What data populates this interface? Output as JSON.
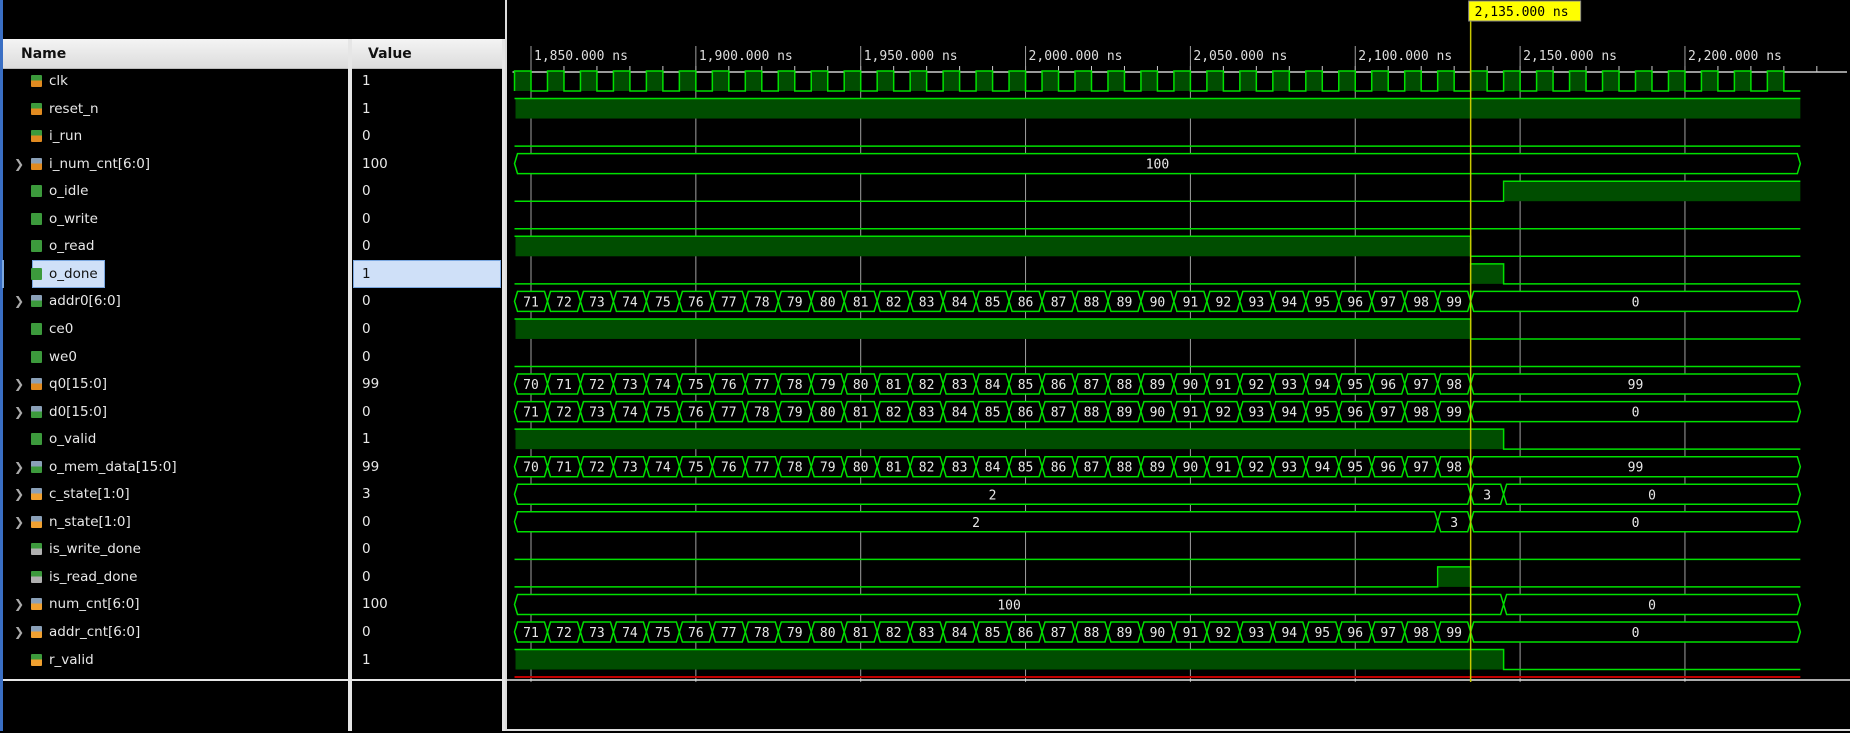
{
  "header": {
    "name_label": "Name",
    "value_label": "Value"
  },
  "colors": {
    "wave": "#00e000",
    "wave_fill": "#004d00",
    "cursor": "#c8c800",
    "cursor_label_bg": "#ffff00",
    "grid": "#a0a0a0",
    "selection": "#cfe0f8"
  },
  "timeline": {
    "unit": "ns",
    "range_ns": [
      1845,
      2235
    ],
    "major_ticks": [
      {
        "t": 1850,
        "label": "1,850.000 ns"
      },
      {
        "t": 1900,
        "label": "1,900.000 ns"
      },
      {
        "t": 1950,
        "label": "1,950.000 ns"
      },
      {
        "t": 2000,
        "label": "2,000.000 ns"
      },
      {
        "t": 2050,
        "label": "2,050.000 ns"
      },
      {
        "t": 2100,
        "label": "2,100.000 ns"
      },
      {
        "t": 2150,
        "label": "2,150.000 ns"
      },
      {
        "t": 2200,
        "label": "2,200.000 ns"
      }
    ],
    "minor_tick_step_ns": 10,
    "cursor": {
      "t": 2135,
      "label": "2,135.000 ns"
    }
  },
  "signals": [
    {
      "name": "clk",
      "value": "1",
      "icon": "input-bit-icon",
      "kind": "clock",
      "clock": {
        "period_ns": 10,
        "first_rise_ns": 1855
      }
    },
    {
      "name": "reset_n",
      "value": "1",
      "icon": "input-bit-icon",
      "kind": "bit",
      "wave": [
        [
          1845,
          1
        ]
      ]
    },
    {
      "name": "i_run",
      "value": "0",
      "icon": "input-bit-icon",
      "kind": "bit",
      "wave": [
        [
          1845,
          0
        ]
      ]
    },
    {
      "name": "i_num_cnt[6:0]",
      "value": "100",
      "icon": "input-bus-icon",
      "kind": "bus",
      "expandable": true,
      "wave": [
        [
          1845,
          "100"
        ]
      ]
    },
    {
      "name": "o_idle",
      "value": "0",
      "icon": "output-bit-icon",
      "kind": "bit",
      "wave": [
        [
          1845,
          0
        ],
        [
          2145,
          1
        ]
      ]
    },
    {
      "name": "o_write",
      "value": "0",
      "icon": "output-bit-icon",
      "kind": "bit",
      "wave": [
        [
          1845,
          0
        ]
      ]
    },
    {
      "name": "o_read",
      "value": "0",
      "icon": "output-bit-icon",
      "kind": "bit",
      "wave": [
        [
          1845,
          1
        ],
        [
          2135,
          0
        ]
      ]
    },
    {
      "name": "o_done",
      "value": "1",
      "icon": "output-bit-icon",
      "kind": "bit",
      "selected": true,
      "wave": [
        [
          1845,
          0
        ],
        [
          2135,
          1
        ],
        [
          2145,
          0
        ]
      ]
    },
    {
      "name": "addr0[6:0]",
      "value": "0",
      "icon": "output-bus-icon",
      "kind": "bus",
      "expandable": true,
      "wave": [
        [
          1845,
          "71"
        ],
        [
          1855,
          "72"
        ],
        [
          1865,
          "73"
        ],
        [
          1875,
          "74"
        ],
        [
          1885,
          "75"
        ],
        [
          1895,
          "76"
        ],
        [
          1905,
          "77"
        ],
        [
          1915,
          "78"
        ],
        [
          1925,
          "79"
        ],
        [
          1935,
          "80"
        ],
        [
          1945,
          "81"
        ],
        [
          1955,
          "82"
        ],
        [
          1965,
          "83"
        ],
        [
          1975,
          "84"
        ],
        [
          1985,
          "85"
        ],
        [
          1995,
          "86"
        ],
        [
          2005,
          "87"
        ],
        [
          2015,
          "88"
        ],
        [
          2025,
          "89"
        ],
        [
          2035,
          "90"
        ],
        [
          2045,
          "91"
        ],
        [
          2055,
          "92"
        ],
        [
          2065,
          "93"
        ],
        [
          2075,
          "94"
        ],
        [
          2085,
          "95"
        ],
        [
          2095,
          "96"
        ],
        [
          2105,
          "97"
        ],
        [
          2115,
          "98"
        ],
        [
          2125,
          "99"
        ],
        [
          2135,
          "0"
        ]
      ]
    },
    {
      "name": "ce0",
      "value": "0",
      "icon": "output-bit-icon",
      "kind": "bit",
      "wave": [
        [
          1845,
          1
        ],
        [
          2135,
          0
        ]
      ]
    },
    {
      "name": "we0",
      "value": "0",
      "icon": "output-bit-icon",
      "kind": "bit",
      "wave": [
        [
          1845,
          0
        ]
      ]
    },
    {
      "name": "q0[15:0]",
      "value": "99",
      "icon": "input-bus-icon",
      "kind": "bus",
      "expandable": true,
      "wave": [
        [
          1845,
          "70"
        ],
        [
          1855,
          "71"
        ],
        [
          1865,
          "72"
        ],
        [
          1875,
          "73"
        ],
        [
          1885,
          "74"
        ],
        [
          1895,
          "75"
        ],
        [
          1905,
          "76"
        ],
        [
          1915,
          "77"
        ],
        [
          1925,
          "78"
        ],
        [
          1935,
          "79"
        ],
        [
          1945,
          "80"
        ],
        [
          1955,
          "81"
        ],
        [
          1965,
          "82"
        ],
        [
          1975,
          "83"
        ],
        [
          1985,
          "84"
        ],
        [
          1995,
          "85"
        ],
        [
          2005,
          "86"
        ],
        [
          2015,
          "87"
        ],
        [
          2025,
          "88"
        ],
        [
          2035,
          "89"
        ],
        [
          2045,
          "90"
        ],
        [
          2055,
          "91"
        ],
        [
          2065,
          "92"
        ],
        [
          2075,
          "93"
        ],
        [
          2085,
          "94"
        ],
        [
          2095,
          "95"
        ],
        [
          2105,
          "96"
        ],
        [
          2115,
          "97"
        ],
        [
          2125,
          "98"
        ],
        [
          2135,
          "99"
        ]
      ]
    },
    {
      "name": "d0[15:0]",
      "value": "0",
      "icon": "output-bus-icon",
      "kind": "bus",
      "expandable": true,
      "wave": [
        [
          1845,
          "71"
        ],
        [
          1855,
          "72"
        ],
        [
          1865,
          "73"
        ],
        [
          1875,
          "74"
        ],
        [
          1885,
          "75"
        ],
        [
          1895,
          "76"
        ],
        [
          1905,
          "77"
        ],
        [
          1915,
          "78"
        ],
        [
          1925,
          "79"
        ],
        [
          1935,
          "80"
        ],
        [
          1945,
          "81"
        ],
        [
          1955,
          "82"
        ],
        [
          1965,
          "83"
        ],
        [
          1975,
          "84"
        ],
        [
          1985,
          "85"
        ],
        [
          1995,
          "86"
        ],
        [
          2005,
          "87"
        ],
        [
          2015,
          "88"
        ],
        [
          2025,
          "89"
        ],
        [
          2035,
          "90"
        ],
        [
          2045,
          "91"
        ],
        [
          2055,
          "92"
        ],
        [
          2065,
          "93"
        ],
        [
          2075,
          "94"
        ],
        [
          2085,
          "95"
        ],
        [
          2095,
          "96"
        ],
        [
          2105,
          "97"
        ],
        [
          2115,
          "98"
        ],
        [
          2125,
          "99"
        ],
        [
          2135,
          "0"
        ]
      ]
    },
    {
      "name": "o_valid",
      "value": "1",
      "icon": "output-bit-icon",
      "kind": "bit",
      "wave": [
        [
          1845,
          1
        ],
        [
          2145,
          0
        ]
      ]
    },
    {
      "name": "o_mem_data[15:0]",
      "value": "99",
      "icon": "output-bus-icon",
      "kind": "bus",
      "expandable": true,
      "wave": [
        [
          1845,
          "70"
        ],
        [
          1855,
          "71"
        ],
        [
          1865,
          "72"
        ],
        [
          1875,
          "73"
        ],
        [
          1885,
          "74"
        ],
        [
          1895,
          "75"
        ],
        [
          1905,
          "76"
        ],
        [
          1915,
          "77"
        ],
        [
          1925,
          "78"
        ],
        [
          1935,
          "79"
        ],
        [
          1945,
          "80"
        ],
        [
          1955,
          "81"
        ],
        [
          1965,
          "82"
        ],
        [
          1975,
          "83"
        ],
        [
          1985,
          "84"
        ],
        [
          1995,
          "85"
        ],
        [
          2005,
          "86"
        ],
        [
          2015,
          "87"
        ],
        [
          2025,
          "88"
        ],
        [
          2035,
          "89"
        ],
        [
          2045,
          "90"
        ],
        [
          2055,
          "91"
        ],
        [
          2065,
          "92"
        ],
        [
          2075,
          "93"
        ],
        [
          2085,
          "94"
        ],
        [
          2095,
          "95"
        ],
        [
          2105,
          "96"
        ],
        [
          2115,
          "97"
        ],
        [
          2125,
          "98"
        ],
        [
          2135,
          "99"
        ]
      ]
    },
    {
      "name": "c_state[1:0]",
      "value": "3",
      "icon": "internal-bus-icon",
      "kind": "bus",
      "expandable": true,
      "wave": [
        [
          1845,
          "2"
        ],
        [
          2135,
          "3"
        ],
        [
          2145,
          "0"
        ]
      ]
    },
    {
      "name": "n_state[1:0]",
      "value": "0",
      "icon": "internal-bus-icon",
      "kind": "bus",
      "expandable": true,
      "wave": [
        [
          1845,
          "2"
        ],
        [
          2125,
          "3"
        ],
        [
          2135,
          "0"
        ]
      ]
    },
    {
      "name": "is_write_done",
      "value": "0",
      "icon": "internal-bit-gray-icon",
      "kind": "bit",
      "wave": [
        [
          1845,
          0
        ]
      ]
    },
    {
      "name": "is_read_done",
      "value": "0",
      "icon": "internal-bit-gray-icon",
      "kind": "bit",
      "wave": [
        [
          1845,
          0
        ],
        [
          2125,
          1
        ],
        [
          2135,
          0
        ]
      ]
    },
    {
      "name": "num_cnt[6:0]",
      "value": "100",
      "icon": "internal-bus-icon",
      "kind": "bus",
      "expandable": true,
      "wave": [
        [
          1845,
          "100"
        ],
        [
          2145,
          "0"
        ]
      ]
    },
    {
      "name": "addr_cnt[6:0]",
      "value": "0",
      "icon": "internal-bus-icon",
      "kind": "bus",
      "expandable": true,
      "wave": [
        [
          1845,
          "71"
        ],
        [
          1855,
          "72"
        ],
        [
          1865,
          "73"
        ],
        [
          1875,
          "74"
        ],
        [
          1885,
          "75"
        ],
        [
          1895,
          "76"
        ],
        [
          1905,
          "77"
        ],
        [
          1915,
          "78"
        ],
        [
          1925,
          "79"
        ],
        [
          1935,
          "80"
        ],
        [
          1945,
          "81"
        ],
        [
          1955,
          "82"
        ],
        [
          1965,
          "83"
        ],
        [
          1975,
          "84"
        ],
        [
          1985,
          "85"
        ],
        [
          1995,
          "86"
        ],
        [
          2005,
          "87"
        ],
        [
          2015,
          "88"
        ],
        [
          2025,
          "89"
        ],
        [
          2035,
          "90"
        ],
        [
          2045,
          "91"
        ],
        [
          2055,
          "92"
        ],
        [
          2065,
          "93"
        ],
        [
          2075,
          "94"
        ],
        [
          2085,
          "95"
        ],
        [
          2095,
          "96"
        ],
        [
          2105,
          "97"
        ],
        [
          2115,
          "98"
        ],
        [
          2125,
          "99"
        ],
        [
          2135,
          "0"
        ]
      ]
    },
    {
      "name": "r_valid",
      "value": "1",
      "icon": "internal-bit-icon",
      "kind": "bit",
      "wave": [
        [
          1845,
          1
        ],
        [
          2145,
          0
        ]
      ]
    }
  ]
}
